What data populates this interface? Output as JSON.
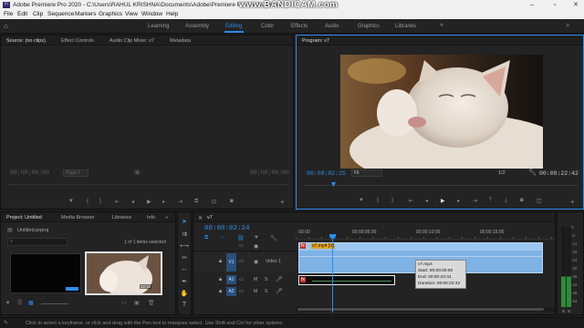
{
  "titlebar": {
    "title": "Adobe Premiere Pro 2020 - C:\\Users\\RAHUL KRISHNA\\Documents\\Adobe\\Premiere Pro\\14.0\\Untitled",
    "watermark": "www.BANDICAM.com",
    "app_icon": "Pr",
    "buttons": {
      "minimize": "–",
      "maximize": "▫",
      "close": "✕"
    }
  },
  "menu": [
    "File",
    "Edit",
    "Clip",
    "Sequence",
    "Markers",
    "Graphics",
    "View",
    "Window",
    "Help"
  ],
  "workspaces": [
    "Learning",
    "Assembly",
    "Editing",
    "Color",
    "Effects",
    "Audio",
    "Graphics",
    "Libraries"
  ],
  "workspace_active": "Editing",
  "workspace_more": "»",
  "source": {
    "tabs": [
      "Source: (no clips)",
      "Effect Controls",
      "Audio Clip Mixer: v7",
      "Metadata"
    ],
    "tc_left": "00;00;00;00",
    "tc_right": "00;00;00;00",
    "page": "Page 1"
  },
  "program": {
    "tab": "Program: v7",
    "tc_left": "00:00:02:25",
    "fit": "Fit",
    "ratio": "1/2",
    "tc_right": "00:00:22:42"
  },
  "project": {
    "tabs": [
      "Project: Untitled",
      "Media Browser",
      "Libraries",
      "Info"
    ],
    "file": "Untitled.prproj",
    "items_selected": "1 of 1 items selected",
    "clip_thumb_dur": "22:42"
  },
  "timeline": {
    "tab": "v7",
    "tc": "00:00:02:24",
    "ruler": [
      ":00:00",
      "00:00:05:00",
      "00:00:10:00",
      "00:00:15:00"
    ],
    "video_track": "V1",
    "video_label": "Video 1",
    "audio_tracks": [
      "A1",
      "A2"
    ],
    "clip_label": "v7.mp4 [V]",
    "fx": "fx",
    "toggle_labels": [
      "M",
      "S"
    ],
    "tooltip": {
      "name": "v7.mp4",
      "start": "Start: 00:00:00:00",
      "end": "End: 00:00:22:41",
      "duration": "Duration: 00:00:22:42"
    }
  },
  "meters": [
    "0",
    "-6",
    "-12",
    "-18",
    "-24",
    "-30",
    "-36",
    "-42",
    "-48",
    "-54"
  ],
  "meter_solo": "S",
  "status": "Click to select a keyframe, or click and drag with the Pen tool to marquee select. Use Shift and Ctrl for other options."
}
